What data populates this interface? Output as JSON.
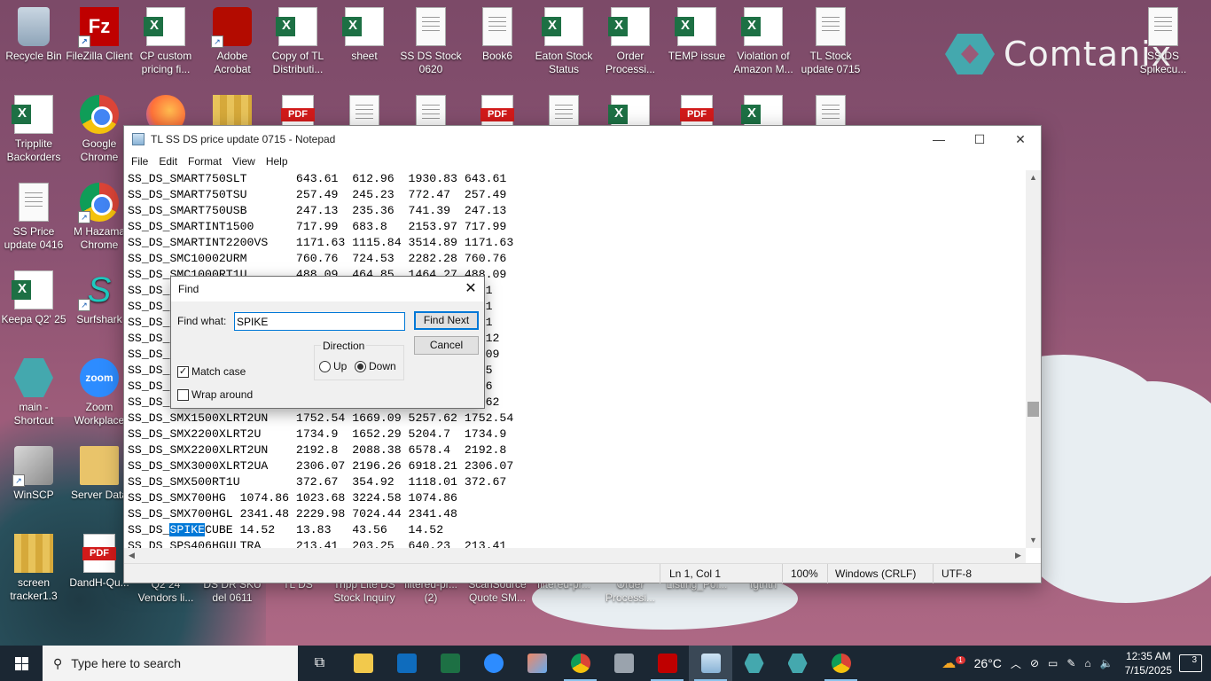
{
  "desktop": {
    "brand": "Comtanix",
    "icons": [
      {
        "label": "Recycle Bin",
        "kind": "bin"
      },
      {
        "label": "FileZilla Client",
        "kind": "fz"
      },
      {
        "label": "CP custom pricing fi...",
        "kind": "xls"
      },
      {
        "label": "Adobe Acrobat",
        "kind": "acro"
      },
      {
        "label": "Copy of TL Distributi...",
        "kind": "xls"
      },
      {
        "label": "sheet",
        "kind": "xls"
      },
      {
        "label": "SS DS Stock 0620",
        "kind": "doc"
      },
      {
        "label": "Book6",
        "kind": "doc"
      },
      {
        "label": "Eaton Stock Status",
        "kind": "xls"
      },
      {
        "label": "Order Processi...",
        "kind": "xls"
      },
      {
        "label": "TEMP issue",
        "kind": "xls"
      },
      {
        "label": "Violation of Amazon M...",
        "kind": "xls"
      },
      {
        "label": "TL Stock update 0715",
        "kind": "doc"
      },
      {
        "label": "SS DS Spikecu...",
        "kind": "doc"
      },
      {
        "label": "Tripplite Backorders",
        "kind": "xls"
      },
      {
        "label": "Google Chrome",
        "kind": "chrome"
      },
      {
        "label": "SS Price update 0416",
        "kind": "doc"
      },
      {
        "label": "M Hazama Chrome",
        "kind": "chrome"
      },
      {
        "label": "Keepa Q2' 25",
        "kind": "xls"
      },
      {
        "label": "Surfshark",
        "kind": "surf"
      },
      {
        "label": "main - Shortcut",
        "kind": "main"
      },
      {
        "label": "Zoom Workplace",
        "kind": "zoom"
      },
      {
        "label": "WinSCP",
        "kind": "winscp"
      },
      {
        "label": "Server Data",
        "kind": "folder"
      },
      {
        "label": "screen tracker1.3",
        "kind": "zip"
      },
      {
        "label": "DandH-Qu...",
        "kind": "pdf"
      },
      {
        "label": "Q2 24 Vendors li...",
        "kind": "hidden"
      },
      {
        "label": "DS DR SKU del 0611",
        "kind": "hidden"
      },
      {
        "label": "TL DS",
        "kind": "hidden"
      },
      {
        "label": "Tripp Lite DS Stock Inquiry",
        "kind": "hidden"
      },
      {
        "label": "filtered-pr... (2)",
        "kind": "hidden"
      },
      {
        "label": "ScanSource Quote SM...",
        "kind": "hidden"
      },
      {
        "label": "filtered-pr...",
        "kind": "hidden"
      },
      {
        "label": "Order Processi...",
        "kind": "hidden"
      },
      {
        "label": "Listing_Pol...",
        "kind": "hidden"
      },
      {
        "label": "fgthth",
        "kind": "hidden"
      }
    ]
  },
  "notepad": {
    "title": "TL SS DS price update 0715  - Notepad",
    "menu": [
      "File",
      "Edit",
      "Format",
      "View",
      "Help"
    ],
    "lines": [
      "SS_DS_SMART750SLT       643.61  612.96  1930.83 643.61",
      "SS_DS_SMART750TSU       257.49  245.23  772.47  257.49",
      "SS_DS_SMART750USB       247.13  235.36  741.39  247.13",
      "SS_DS_SMARTINT1500      717.99  683.8   2153.97 717.99",
      "SS_DS_SMARTINT2200VS    1171.63 1115.84 3514.89 1171.63",
      "SS_DS_SMC10002URM       760.76  724.53  2282.28 760.76",
      "SS_DS_SMC1000RT1U       488.09  464.85  1464.27 488.09",
      "SS_DS_                                          5.41",
      "SS_DS_                                          5.71",
      "SS_DS_                                          7.11",
      "SS_DS_                                          17.12",
      "SS_DS_                                          31.09",
      "SS_DS_                                          3.55",
      "SS_DS_                                          0.06",
      "SS_DS_                                          94.62",
      "SS_DS_SMX1500XLRT2UN    1752.54 1669.09 5257.62 1752.54",
      "SS_DS_SMX2200XLRT2U     1734.9  1652.29 5204.7  1734.9",
      "SS_DS_SMX2200XLRT2UN    2192.8  2088.38 6578.4  2192.8",
      "SS_DS_SMX3000XLRT2UA    2306.07 2196.26 6918.21 2306.07",
      "SS_DS_SMX500RT1U        372.67  354.92  1118.01 372.67",
      "SS_DS_SMX700HG  1074.86 1023.68 3224.58 1074.86",
      "SS_DS_SMX700HGL 2341.48 2229.98 7024.44 2341.48",
      "SS_DS_SPIKECUBE 14.52   13.83   43.56   14.52",
      "SS_DS_SPS406HGULTRA     213.41  203.25  640.23  213.41"
    ],
    "highlight": {
      "prefix": "SS_DS_",
      "match": "SPIKE",
      "suffix": "CUBE 14.52   13.83   43.56   14.52"
    },
    "status": {
      "position": "Ln 1, Col 1",
      "zoom": "100%",
      "eol": "Windows (CRLF)",
      "encoding": "UTF-8"
    }
  },
  "find": {
    "title": "Find",
    "label": "Find what:",
    "value": "SPIKE",
    "find_next": "Find Next",
    "cancel": "Cancel",
    "direction": "Direction",
    "up": "Up",
    "down": "Down",
    "direction_selected": "Down",
    "match_case": "Match case",
    "match_case_checked": true,
    "wrap_around": "Wrap around",
    "wrap_around_checked": false
  },
  "taskbar": {
    "search_placeholder": "Type here to search",
    "weather": "26°C",
    "time": "12:35 AM",
    "date": "7/15/2025",
    "notifications": "3",
    "weather_badge": "1"
  }
}
